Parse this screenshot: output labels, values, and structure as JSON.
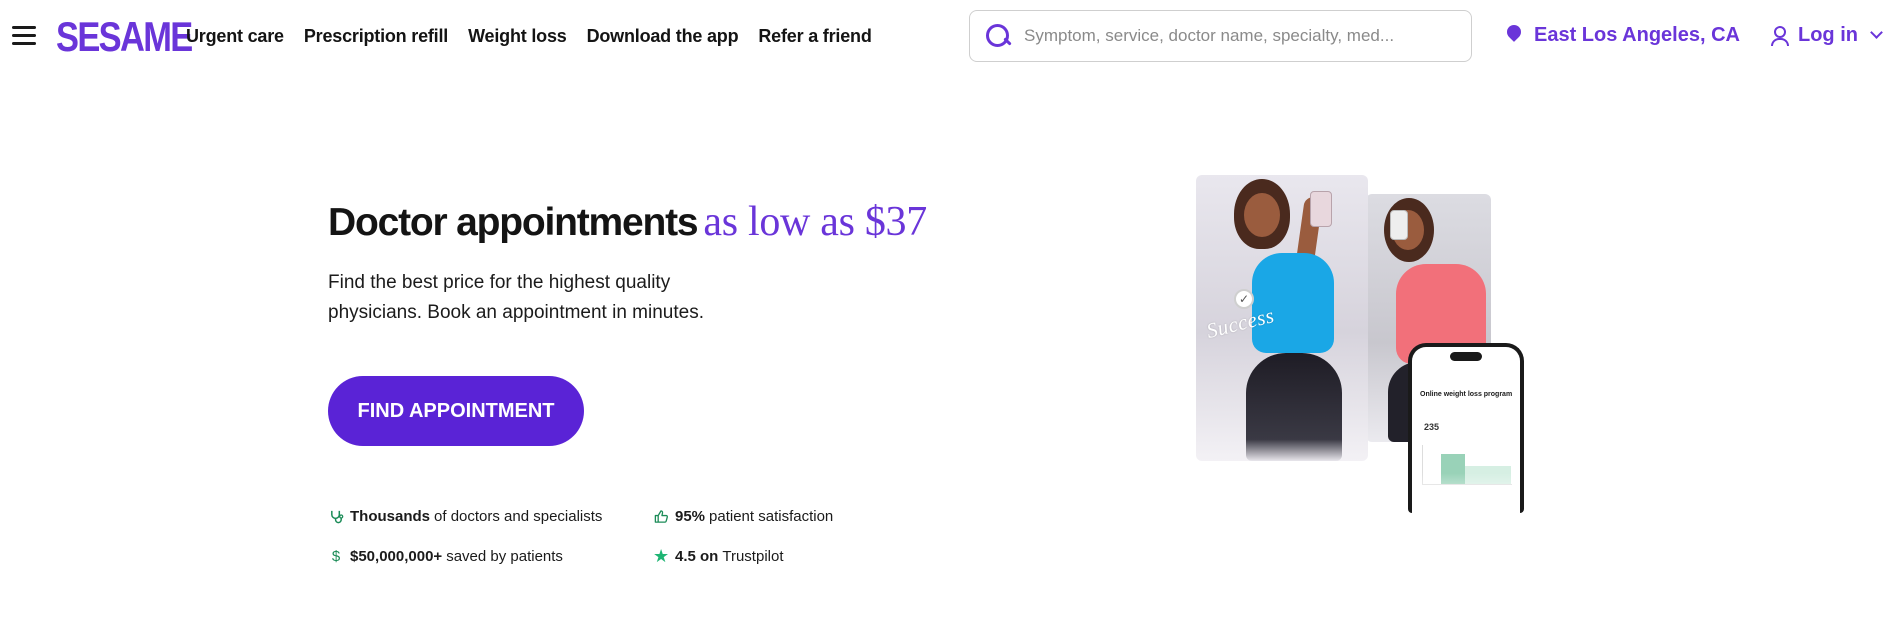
{
  "brand": {
    "logo_text": "SESAME",
    "accent": "#6a35d9",
    "cta_color": "#5a23d6"
  },
  "nav": {
    "links": [
      "Urgent care",
      "Prescription refill",
      "Weight loss",
      "Download the app",
      "Refer a friend"
    ],
    "search_placeholder": "Symptom, service, doctor name, specialty, med...",
    "location": "East Los Angeles, CA",
    "login": "Log in"
  },
  "hero": {
    "title": "Doctor appointments",
    "title_accent": "as low as $37",
    "subtitle_line1": "Find the best price for the highest quality",
    "subtitle_line2": "physicians. Book an appointment in minutes.",
    "cta": "FIND APPOINTMENT"
  },
  "stats": [
    {
      "icon": "stethoscope-icon",
      "strong": "Thousands",
      "text": "of doctors and specialists"
    },
    {
      "icon": "thumbs-up-icon",
      "strong": "95%",
      "text": "patient satisfaction"
    },
    {
      "icon": "dollar-icon",
      "strong": "$50,000,000+",
      "text": "saved by patients"
    },
    {
      "icon": "star-icon",
      "strong": "4.5 on",
      "text": "Trustpilot"
    }
  ],
  "promo_image": {
    "badge_text": "Success",
    "phone_title": "Online weight loss program",
    "phone_weight": "235"
  }
}
